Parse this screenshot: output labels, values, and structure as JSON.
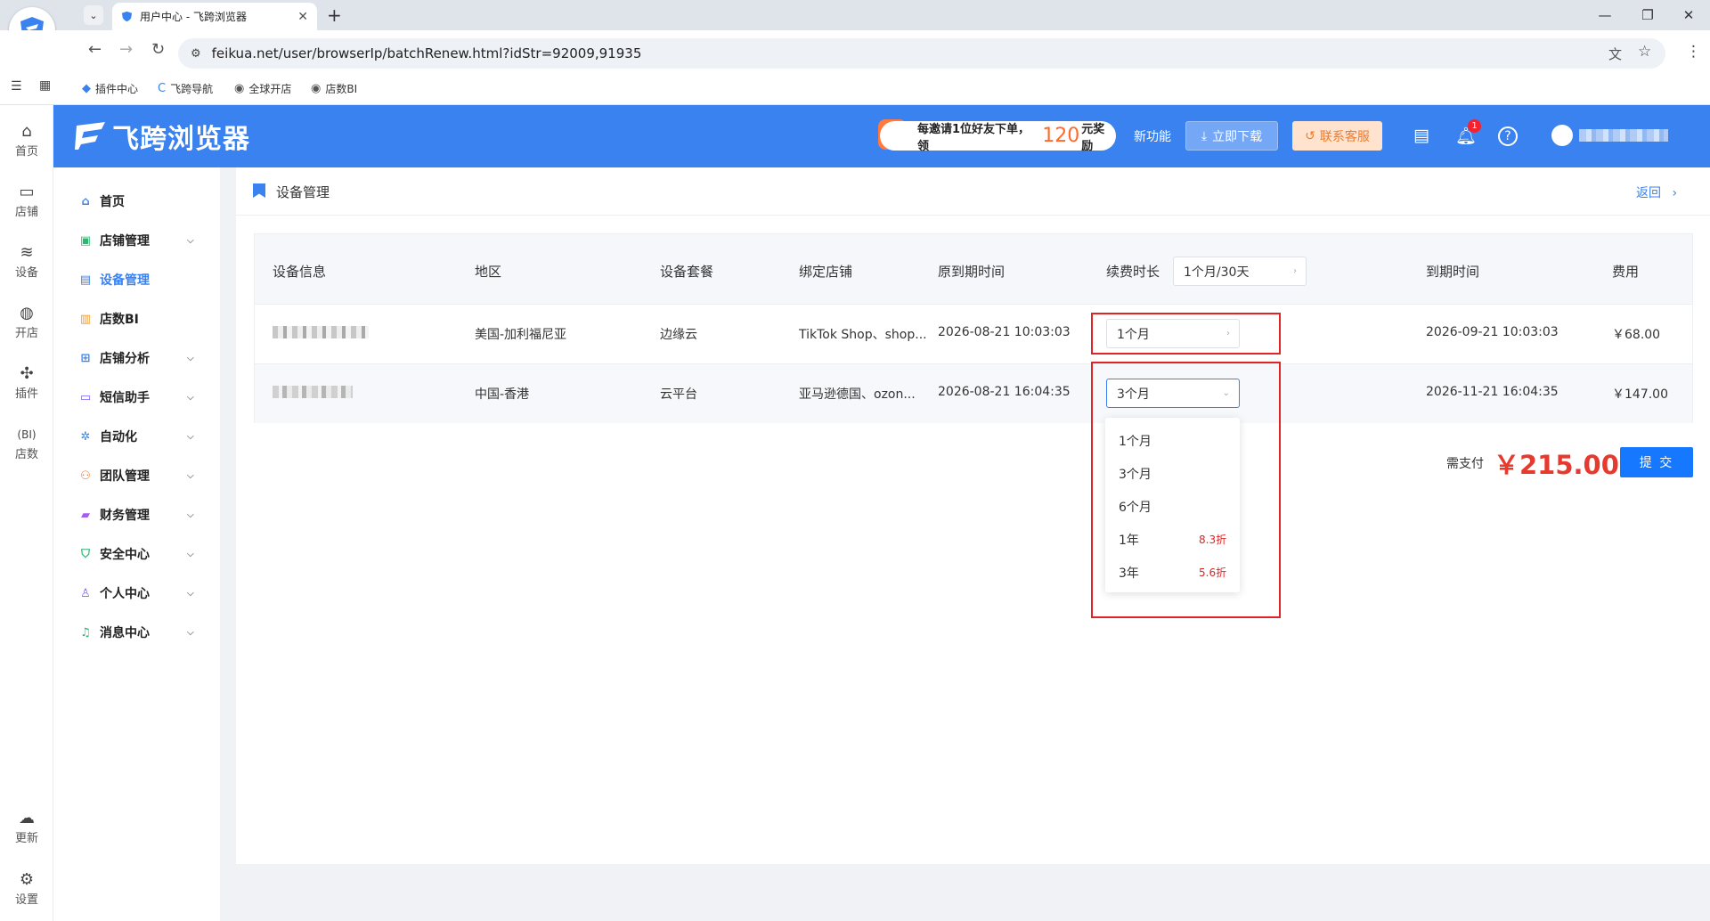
{
  "browser": {
    "tab_title": "用户中心 - 飞跨浏览器",
    "url": "feikua.net/user/browserIp/batchRenew.html?idStr=92009,91935",
    "bookmarks": [
      "插件中心",
      "飞跨导航",
      "全球开店",
      "店数BI"
    ]
  },
  "rail": {
    "items": [
      "首页",
      "店铺",
      "设备",
      "开店",
      "插件",
      "店数"
    ],
    "bottom": [
      "更新",
      "设置"
    ]
  },
  "header": {
    "brand": "飞跨浏览器",
    "invite_prefix": "每邀请1位好友下单，领",
    "invite_amount": "120",
    "invite_suffix": "元奖励",
    "new_features": "新功能",
    "download": "立即下载",
    "contact": "联系客服",
    "notification_count": "1"
  },
  "sidebar": {
    "items": [
      {
        "label": "首页",
        "icon": "home-icon"
      },
      {
        "label": "店铺管理",
        "icon": "shop-icon"
      },
      {
        "label": "设备管理",
        "icon": "device-icon"
      },
      {
        "label": "店数BI",
        "icon": "chart-icon"
      },
      {
        "label": "店铺分析",
        "icon": "analysis-icon"
      },
      {
        "label": "短信助手",
        "icon": "sms-icon"
      },
      {
        "label": "自动化",
        "icon": "automation-icon"
      },
      {
        "label": "团队管理",
        "icon": "team-icon"
      },
      {
        "label": "财务管理",
        "icon": "wallet-icon"
      },
      {
        "label": "安全中心",
        "icon": "shield-icon"
      },
      {
        "label": "个人中心",
        "icon": "user-icon"
      },
      {
        "label": "消息中心",
        "icon": "bell-icon"
      }
    ],
    "active": "设备管理"
  },
  "page": {
    "breadcrumb": "设备管理",
    "back": "返回"
  },
  "table": {
    "headers": [
      "设备信息",
      "地区",
      "设备套餐",
      "绑定店铺",
      "原到期时间",
      "续费时长",
      "到期时间",
      "费用"
    ],
    "bulk_duration": "1个月/30天",
    "rows": [
      {
        "region": "美国-加利福尼亚",
        "plan": "边缘云",
        "shops": "TikTok Shop、shop...",
        "old_expiry": "2026-08-21 10:03:03",
        "duration": "1个月",
        "new_expiry": "2026-09-21 10:03:03",
        "fee": "￥68.00"
      },
      {
        "region": "中国-香港",
        "plan": "云平台",
        "shops": "亚马逊德国、ozon...",
        "old_expiry": "2026-08-21 16:04:35",
        "duration": "3个月",
        "new_expiry": "2026-11-21 16:04:35",
        "fee": "￥147.00"
      }
    ]
  },
  "dropdown": {
    "options": [
      {
        "label": "1个月",
        "discount": ""
      },
      {
        "label": "3个月",
        "discount": ""
      },
      {
        "label": "6个月",
        "discount": ""
      },
      {
        "label": "1年",
        "discount": "8.3折"
      },
      {
        "label": "3年",
        "discount": "5.6折"
      }
    ]
  },
  "payment": {
    "label": "需支付",
    "amount": "￥215.00",
    "submit": "提 交"
  },
  "colors": {
    "brand": "#3a82f0",
    "accent_red": "#e63a2e",
    "submit": "#1677ff"
  }
}
